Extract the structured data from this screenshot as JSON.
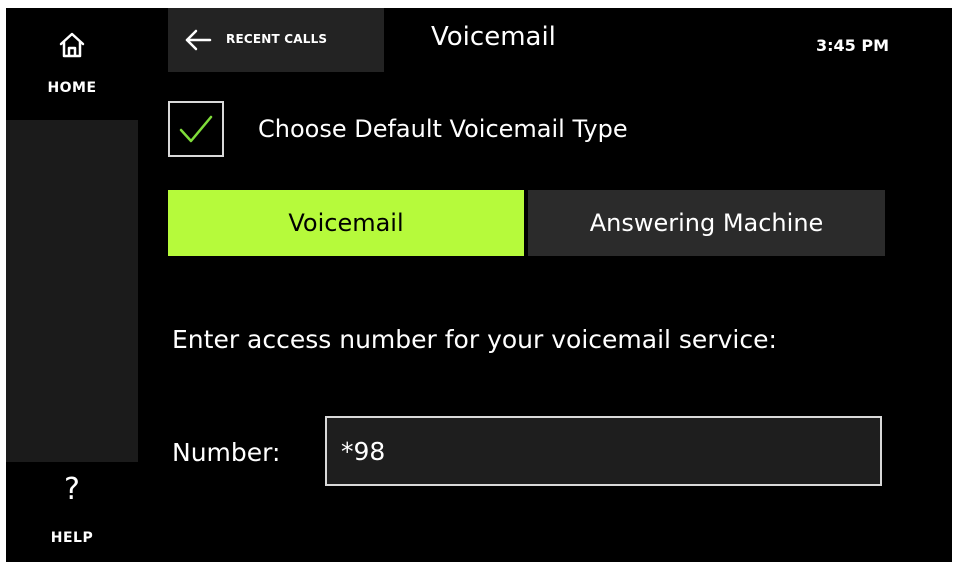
{
  "sidebar": {
    "home": {
      "label": "HOME",
      "icon": "home-icon"
    },
    "help": {
      "label": "HELP",
      "icon": "question-icon",
      "glyph": "?"
    }
  },
  "header": {
    "back_label": "RECENT CALLS",
    "title": "Voicemail",
    "time": "3:45 PM"
  },
  "settings": {
    "default_type_label": "Choose Default Voicemail Type",
    "default_type_checked": true,
    "type_options": [
      {
        "label": "Voicemail",
        "selected": true
      },
      {
        "label": "Answering Machine",
        "selected": false
      }
    ],
    "prompt": "Enter access number for your voicemail service:",
    "number_label": "Number:",
    "number_value": "*98"
  },
  "colors": {
    "accent": "#b6fa3b",
    "background": "#000000",
    "panel": "#2b2b2b",
    "checkmark": "#7fdc3a"
  }
}
